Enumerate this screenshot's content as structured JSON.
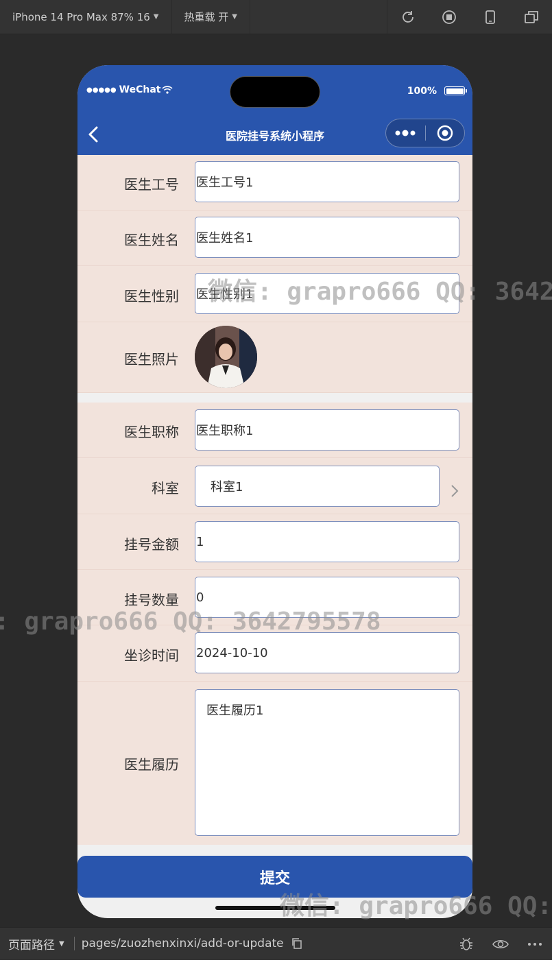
{
  "devtools": {
    "device": "iPhone 14 Pro Max 87% 16",
    "hot_reload": "热重载 开",
    "icons": [
      "refresh-icon",
      "stop-icon",
      "phone-icon",
      "window-icon"
    ]
  },
  "status_bar": {
    "carrier": "WeChat",
    "battery": "100%"
  },
  "nav": {
    "title": "医院挂号系统小程序"
  },
  "form": {
    "doctor_id": {
      "label": "医生工号",
      "value": "医生工号1"
    },
    "doctor_name": {
      "label": "医生姓名",
      "value": "医生姓名1"
    },
    "doctor_gender": {
      "label": "医生性别",
      "value": "医生性别1"
    },
    "doctor_photo": {
      "label": "医生照片"
    },
    "doctor_title": {
      "label": "医生职称",
      "value": "医生职称1"
    },
    "department": {
      "label": "科室",
      "value": "科室1"
    },
    "fee": {
      "label": "挂号金额",
      "value": "1"
    },
    "quota": {
      "label": "挂号数量",
      "value": "0"
    },
    "clinic_time": {
      "label": "坐诊时间",
      "value": "2024-10-10"
    },
    "resume": {
      "label": "医生履历",
      "value": "医生履历1"
    }
  },
  "submit_label": "提交",
  "watermark": {
    "top": "微信: grapro666 QQ: 3642",
    "middle": ": grapro666 QQ: 3642795578",
    "bottom": "微信: grapro666 QQ:"
  },
  "bottom_bar": {
    "path_label": "页面路径",
    "path": "pages/zuozhenxinxi/add-or-update"
  }
}
